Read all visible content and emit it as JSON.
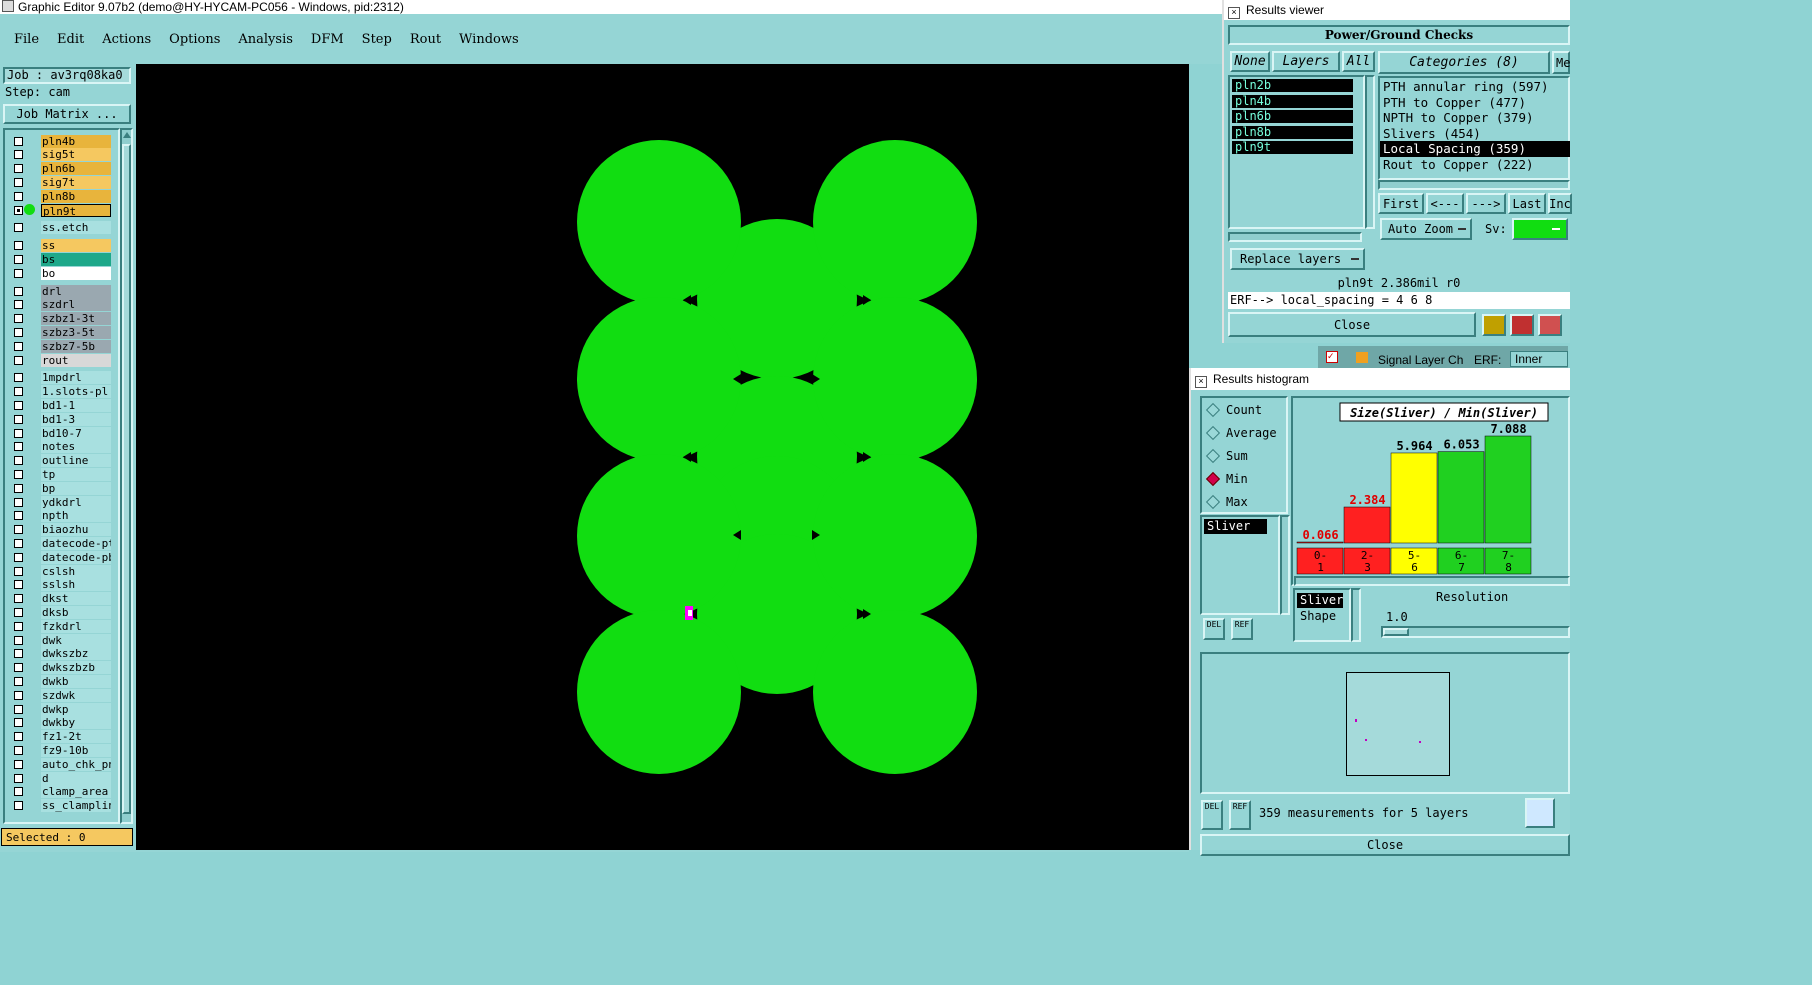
{
  "main_window": {
    "title": "Graphic Editor 9.07b2 (demo@HY-HYCAM-PC056 - Windows, pid:2312)",
    "menu": [
      "File",
      "Edit",
      "Actions",
      "Options",
      "Analysis",
      "DFM",
      "Step",
      "Rout",
      "Windows"
    ]
  },
  "job_panel": {
    "job_label": "Job : av3rq08ka0",
    "step_label": "Step: cam",
    "job_matrix_button": "Job Matrix ...",
    "selected_label": "Selected : 0"
  },
  "layers": [
    {
      "name": "pln4b",
      "color": "#e8b43c",
      "checked": false
    },
    {
      "name": "sig5t",
      "color": "#f5c860",
      "checked": false
    },
    {
      "name": "pln6b",
      "color": "#e8b43c",
      "checked": false
    },
    {
      "name": "sig7t",
      "color": "#f5c860",
      "checked": false
    },
    {
      "name": "pln8b",
      "color": "#e8b43c",
      "checked": false
    },
    {
      "name": "pln9t",
      "color": "#e8b43c",
      "checked": true,
      "active": true
    },
    {
      "gap": true
    },
    {
      "name": "ss.etch",
      "color": "#a8e0e0",
      "checked": false
    },
    {
      "gap": true
    },
    {
      "name": "ss",
      "color": "#f5c860",
      "checked": false
    },
    {
      "name": "bs",
      "color": "#1ea88a",
      "checked": false
    },
    {
      "name": "bo",
      "color": "#ffffff",
      "checked": false
    },
    {
      "gap": true
    },
    {
      "name": "drl",
      "color": "#9aa8b0",
      "checked": false
    },
    {
      "name": "szdrl",
      "color": "#9aa8b0",
      "checked": false
    },
    {
      "name": "szbz1-3t",
      "color": "#9aa8b0",
      "checked": false
    },
    {
      "name": "szbz3-5t",
      "color": "#9aa8b0",
      "checked": false
    },
    {
      "name": "szbz7-5b",
      "color": "#9aa8b0",
      "checked": false
    },
    {
      "name": "rout",
      "color": "#d8d8d8",
      "checked": false
    },
    {
      "gap": true
    },
    {
      "name": "1mpdrl",
      "color": "#a8e0e0",
      "checked": false
    },
    {
      "name": "1.slots-pl",
      "color": "#a8e0e0",
      "checked": false
    },
    {
      "name": "bd1-1",
      "color": "#a8e0e0",
      "checked": false
    },
    {
      "name": "bd1-3",
      "color": "#a8e0e0",
      "checked": false
    },
    {
      "name": "bd10-7",
      "color": "#a8e0e0",
      "checked": false
    },
    {
      "name": "notes",
      "color": "#a8e0e0",
      "checked": false
    },
    {
      "name": "outline",
      "color": "#a8e0e0",
      "checked": false
    },
    {
      "name": "tp",
      "color": "#a8e0e0",
      "checked": false
    },
    {
      "name": "bp",
      "color": "#a8e0e0",
      "checked": false
    },
    {
      "name": "ydkdrl",
      "color": "#a8e0e0",
      "checked": false
    },
    {
      "name": "npth",
      "color": "#a8e0e0",
      "checked": false
    },
    {
      "name": "biaozhu",
      "color": "#a8e0e0",
      "checked": false
    },
    {
      "name": "datecode-pt",
      "color": "#a8e0e0",
      "checked": false
    },
    {
      "name": "datecode-pb",
      "color": "#a8e0e0",
      "checked": false
    },
    {
      "name": "cslsh",
      "color": "#a8e0e0",
      "checked": false
    },
    {
      "name": "sslsh",
      "color": "#a8e0e0",
      "checked": false
    },
    {
      "name": "dkst",
      "color": "#a8e0e0",
      "checked": false
    },
    {
      "name": "dksb",
      "color": "#a8e0e0",
      "checked": false
    },
    {
      "name": "fzkdrl",
      "color": "#a8e0e0",
      "checked": false
    },
    {
      "name": "dwk",
      "color": "#a8e0e0",
      "checked": false
    },
    {
      "name": "dwkszbz",
      "color": "#a8e0e0",
      "checked": false
    },
    {
      "name": "dwkszbzb",
      "color": "#a8e0e0",
      "checked": false
    },
    {
      "name": "dwkb",
      "color": "#a8e0e0",
      "checked": false
    },
    {
      "name": "szdwk",
      "color": "#a8e0e0",
      "checked": false
    },
    {
      "name": "dwkp",
      "color": "#a8e0e0",
      "checked": false
    },
    {
      "name": "dwkby",
      "color": "#a8e0e0",
      "checked": false
    },
    {
      "name": "fz1-2t",
      "color": "#a8e0e0",
      "checked": false
    },
    {
      "name": "fz9-10b",
      "color": "#a8e0e0",
      "checked": false
    },
    {
      "name": "auto_chk_pn",
      "color": "#a8e0e0",
      "checked": false
    },
    {
      "name": "d",
      "color": "#a8e0e0",
      "checked": false
    },
    {
      "name": "clamp_area",
      "color": "#a8e0e0",
      "checked": false
    },
    {
      "name": "ss_clampline",
      "color": "#a8e0e0",
      "checked": false
    }
  ],
  "results_viewer": {
    "title": "Results viewer",
    "header": "Power/Ground Checks",
    "none_btn": "None",
    "layers_btn": "Layers",
    "all_btn": "All",
    "categories_label": "Categories (8)",
    "me_label": "Me",
    "layer_list": [
      "pln2b",
      "pln4b",
      "pln6b",
      "pln8b",
      "pln9t"
    ],
    "categories": [
      "PTH annular ring (597)",
      "PTH to Copper (477)",
      "NPTH to Copper (379)",
      "Slivers (454)",
      "Local Spacing (359)",
      "Rout to Copper (222)"
    ],
    "selected_category": 4,
    "nav": [
      "First",
      "<---",
      "--->",
      "Last",
      "Inc"
    ],
    "auto_zoom": "Auto Zoom",
    "sv_label": "Sv:",
    "replace_layers": "Replace layers",
    "status": "pln9t 2.386mil  r0",
    "erf": "ERF--> local_spacing = 4 6 8",
    "close": "Close"
  },
  "behind_strip": {
    "signal": "Signal Layer Ch",
    "erf": "ERF:",
    "inner": "Inner"
  },
  "histogram": {
    "title": "Results histogram",
    "radios": [
      "Count",
      "Average",
      "Sum",
      "Min",
      "Max"
    ],
    "selected_radio": 3,
    "list_item": "Sliver",
    "chart_title": "Size(Sliver) / Min(Sliver)",
    "bar_labels": [
      "0.066",
      "2.384",
      "5.964",
      "6.053",
      "7.088"
    ],
    "bar_colors": [
      "#ff2020",
      "#ff2020",
      "#ffff00",
      "#20d020",
      "#20d020"
    ],
    "bins": [
      [
        "0-",
        "1"
      ],
      [
        "2-",
        "3"
      ],
      [
        "5-",
        "6"
      ],
      [
        "6-",
        "7"
      ],
      [
        "7-",
        "8"
      ]
    ],
    "del": "DEL",
    "ref": "REF",
    "sliver_item": "Sliver",
    "shape_item": "Shape",
    "resolution_label": "Resolution",
    "resolution_value": "1.0",
    "measurements": "359 measurements for 5 layers",
    "close": "Close"
  },
  "colors": {
    "copper": "#11dd11",
    "canvas": "#000000",
    "panel": "#95d5d5",
    "highlight": "#ff00ff"
  }
}
